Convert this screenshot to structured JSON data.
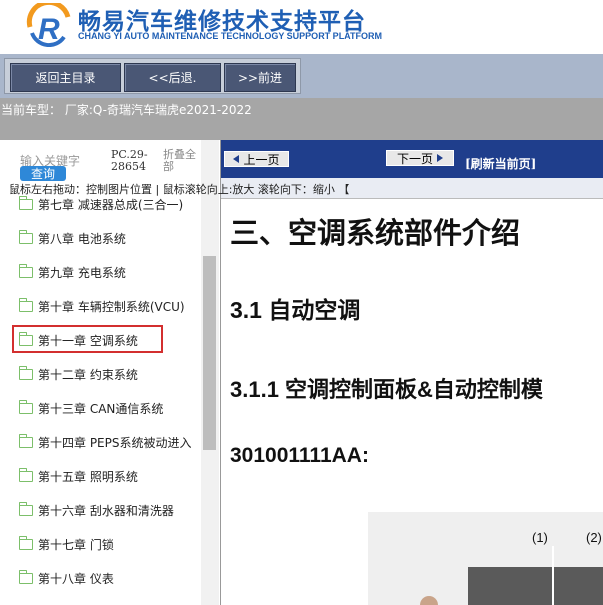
{
  "header": {
    "title": "畅易汽车维修技术支持平台",
    "subtitle": "CHANG YI AUTO MAINTENANCE TECHNOLOGY SUPPORT PLATFORM",
    "logo_letter": "R"
  },
  "toolbar": {
    "home_label": "返回主目录",
    "back_label": "<<后退.",
    "forward_label": ">>前进"
  },
  "car_model": "当前车型： 厂家:Q-奇瑞汽车瑞虎e2021-2022",
  "sidebar": {
    "search_placeholder": "输入关键字",
    "search_button": "查询",
    "pc_code": "PC.29-28654",
    "collapse_all": "折叠全部",
    "items": [
      {
        "label": "第七章 减速器总成(三合一)"
      },
      {
        "label": "第八章 电池系统"
      },
      {
        "label": "第九章 充电系统"
      },
      {
        "label": "第十章 车辆控制系统(VCU)"
      },
      {
        "label": "第十一章 空调系统"
      },
      {
        "label": "第十二章 约束系统"
      },
      {
        "label": "第十三章 CAN通信系统"
      },
      {
        "label": "第十四章 PEPS系统被动进入"
      },
      {
        "label": "第十五章 照明系统"
      },
      {
        "label": "第十六章 刮水器和清洗器"
      },
      {
        "label": "第十七章 门锁"
      },
      {
        "label": "第十八章 仪表"
      }
    ]
  },
  "content": {
    "prev_page": "上一页",
    "next_page": "下一页",
    "refresh": "[刷新当前页]",
    "tip": "鼠标左右拖动：控制图片位置 | 鼠标滚轮向上:放大  滚轮向下：缩小 【",
    "title": "三、空调系统部件介绍",
    "h1": "3.1  自动空调",
    "h2": "3.1.1  空调控制面板&自动控制模",
    "code": "301001111AA:",
    "callout_1": "(1)",
    "callout_2": "(2)"
  },
  "colors": {
    "brand_blue": "#1f5fb4",
    "nav_blue": "#1f3e8c",
    "highlight_red": "#d32f2f",
    "folder_green": "#7cbf6a"
  }
}
